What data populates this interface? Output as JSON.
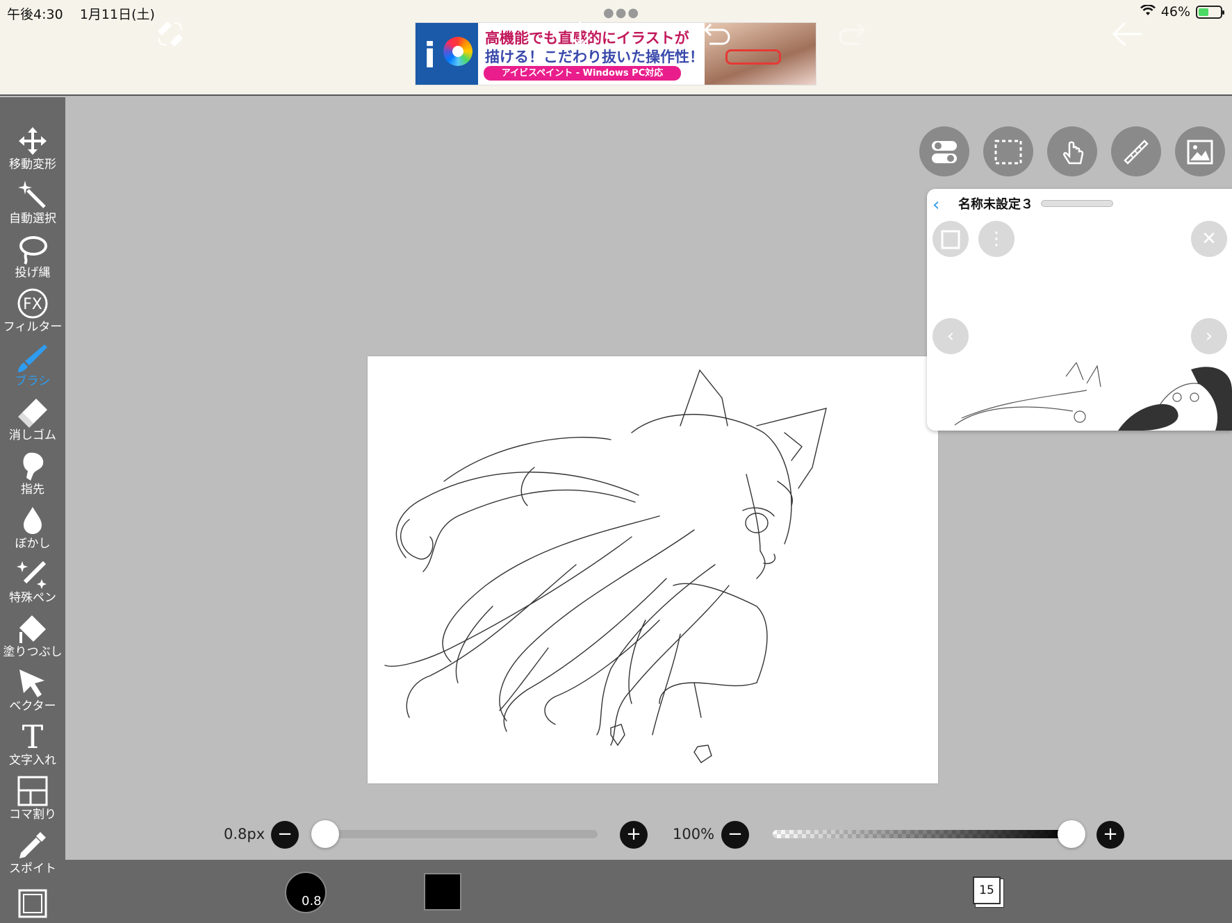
{
  "status": {
    "time": "午後4:30",
    "date": "1月11日(土)",
    "battery": "46%",
    "battery_level": 0.46
  },
  "ad": {
    "line1": "高機能でも直感的にイラストが",
    "line2": "描ける！こだわり抜いた操作性！",
    "line3": "アイビスペイント - Windows PC対応"
  },
  "tools": [
    {
      "label": "移動変形",
      "icon": "move-icon"
    },
    {
      "label": "自動選択",
      "icon": "magic-wand-icon"
    },
    {
      "label": "投げ縄",
      "icon": "lasso-icon"
    },
    {
      "label": "フィルター",
      "icon": "fx-icon"
    },
    {
      "label": "ブラシ",
      "icon": "brush-icon",
      "active": true
    },
    {
      "label": "消しゴム",
      "icon": "eraser-icon"
    },
    {
      "label": "指先",
      "icon": "finger-icon"
    },
    {
      "label": "ぼかし",
      "icon": "blur-icon"
    },
    {
      "label": "特殊ペン",
      "icon": "special-pen-icon"
    },
    {
      "label": "塗りつぶし",
      "icon": "bucket-icon"
    },
    {
      "label": "ベクター",
      "icon": "vector-icon"
    },
    {
      "label": "文字入れ",
      "icon": "text-icon"
    },
    {
      "label": "コマ割り",
      "icon": "frame-divider-icon"
    },
    {
      "label": "スポイト",
      "icon": "eyedropper-icon"
    }
  ],
  "reference": {
    "title": "名称未設定３"
  },
  "brush": {
    "size_label": "0.8px",
    "size_circle": "0.8",
    "size_level": 0.0,
    "opacity_label": "100%",
    "opacity_level": 1.0,
    "color": "#000000"
  },
  "layers": {
    "count": "15"
  },
  "colors": {
    "accent": "#2e9cf0",
    "toolbar": "#686868",
    "workspace": "#bdbdbd"
  }
}
